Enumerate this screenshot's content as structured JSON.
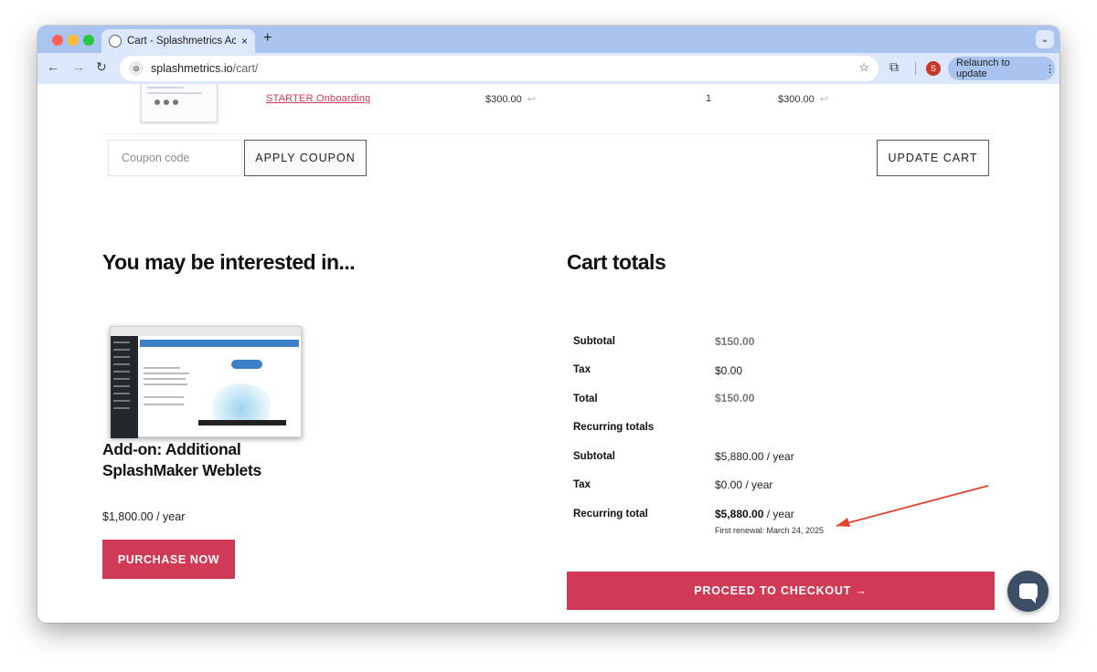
{
  "browser": {
    "tab_title": "Cart - Splashmetrics Account",
    "tab_close": "×",
    "new_tab": "+",
    "url_host": "splashmetrics.io",
    "url_path": "/cart/",
    "relaunch_label": "Relaunch to update",
    "relaunch_menu": "⋮",
    "avatar_letter": "S",
    "icons": {
      "back": "←",
      "forward": "→",
      "reload": "↻",
      "star": "☆",
      "extensions": "⧉",
      "tab_menu": "⌄",
      "site_info": "⊜"
    }
  },
  "cart_row": {
    "product_name": "STARTER Onboarding",
    "price": "$300.00",
    "quantity": "1",
    "subtotal": "$300.00",
    "return_icon": "↩"
  },
  "coupon": {
    "placeholder": "Coupon code",
    "apply_label": "APPLY COUPON",
    "update_label": "UPDATE CART"
  },
  "upsell": {
    "heading": "You may be interested in...",
    "product_title": "Add-on: Additional SplashMaker Weblets",
    "price": "$1,800.00",
    "period": "/ year",
    "button_label": "PURCHASE NOW"
  },
  "totals": {
    "heading": "Cart totals",
    "rows": [
      {
        "label": "Subtotal",
        "value": "$150.00"
      },
      {
        "label": "Tax",
        "value": "$0.00"
      },
      {
        "label": "Total",
        "value": "$150.00"
      },
      {
        "label": "Recurring totals",
        "value": ""
      },
      {
        "label": "Subtotal",
        "value": "$5,880.00 / year"
      },
      {
        "label": "Tax",
        "value": "$0.00 / year"
      },
      {
        "label": "Recurring total",
        "value": "$5,880.00",
        "suffix": "/ year"
      }
    ],
    "first_renewal": "First renewal: March 24, 2025",
    "checkout_label": "PROCEED TO CHECKOUT →"
  },
  "colors": {
    "accent": "#d13a57",
    "annotation_arrow": "#e0442c",
    "chrome_tabstrip": "#a9c4ef",
    "chrome_toolbar": "#dce7fb",
    "chat_bubble": "#3c4d66"
  }
}
